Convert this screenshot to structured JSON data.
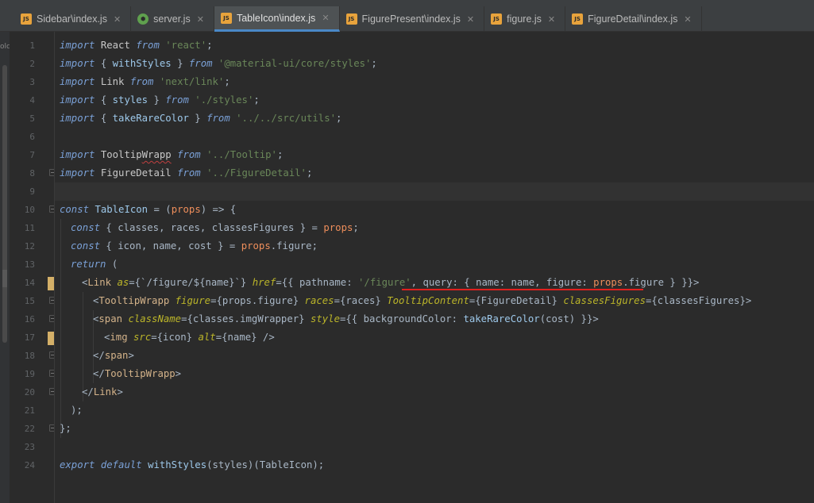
{
  "tabs": [
    {
      "label": "Sidebar\\index.js",
      "icon": "js-file-icon",
      "type": "js",
      "active": false
    },
    {
      "label": "server.js",
      "icon": "nodejs-file-icon",
      "type": "node",
      "active": false
    },
    {
      "label": "TableIcon\\index.js",
      "icon": "js-file-icon",
      "type": "js",
      "active": true
    },
    {
      "label": "FigurePresent\\index.js",
      "icon": "js-file-icon",
      "type": "js",
      "active": false
    },
    {
      "label": "figure.js",
      "icon": "js-file-icon",
      "type": "js",
      "active": false
    },
    {
      "label": "FigureDetail\\index.js",
      "icon": "js-file-icon",
      "type": "js",
      "active": false
    }
  ],
  "left_strip_label": "olc",
  "line_numbers": [
    "1",
    "2",
    "3",
    "4",
    "5",
    "6",
    "7",
    "8",
    "9",
    "10",
    "11",
    "12",
    "13",
    "14",
    "15",
    "16",
    "17",
    "18",
    "19",
    "20",
    "21",
    "22",
    "23",
    "24"
  ],
  "current_line": "9",
  "code": {
    "l1": [
      "import",
      " React ",
      "from",
      " 'react'",
      ";"
    ],
    "l2": [
      "import",
      " { ",
      "withStyles",
      " } ",
      "from",
      " '@material-ui/core/styles'",
      ";"
    ],
    "l3": [
      "import",
      " Link ",
      "from",
      " 'next/link'",
      ";"
    ],
    "l4": [
      "import",
      " { ",
      "styles",
      " } ",
      "from",
      " './styles'",
      ";"
    ],
    "l5": [
      "import",
      " { ",
      "takeRareColor",
      " } ",
      "from",
      " '../../src/utils'",
      ";"
    ],
    "l7": [
      "import",
      " Tooltip",
      "Wrapp",
      " ",
      "from",
      " '../Tooltip'",
      ";"
    ],
    "l8": [
      "import",
      " FigureDetail ",
      "from",
      " '../FigureDetail'",
      ";"
    ],
    "l10": [
      "const",
      " ",
      "TableIcon",
      " = (",
      "props",
      ") => {"
    ],
    "l11": [
      "const",
      " { classes, races, classesFigures } = ",
      "props",
      ";"
    ],
    "l12": [
      "const",
      " { icon, name, cost } = ",
      "props",
      ".figure;"
    ],
    "l13": [
      "return",
      " ("
    ],
    "l14": [
      "<",
      "Link",
      " ",
      "as",
      "={`/figure/${name}`} ",
      "href",
      "={{ pathname: ",
      "'/figure'",
      ", query: { name: name, figure: ",
      "props",
      ".figure } }}>"
    ],
    "l15": [
      "<",
      "TooltipWrapp",
      " ",
      "figure",
      "={props.figure} ",
      "races",
      "={races} ",
      "TooltipContent",
      "={FigureDetail} ",
      "classesFigures",
      "={classesFigures}>"
    ],
    "l16": [
      "<",
      "span",
      " ",
      "className",
      "={classes.imgWrapper} ",
      "style",
      "={{ backgroundColor: ",
      "takeRareColor",
      "(cost) }}>"
    ],
    "l17": [
      "<",
      "img",
      " ",
      "src",
      "={icon} ",
      "alt",
      "={name} />"
    ],
    "l18": [
      "</",
      "span",
      ">"
    ],
    "l19": [
      "</",
      "TooltipWrapp",
      ">"
    ],
    "l20": [
      "</",
      "Link",
      ">"
    ],
    "l21": [
      ");"
    ],
    "l22": [
      "};"
    ],
    "l24": [
      "export",
      " ",
      "default",
      " ",
      "withStyles",
      "(styles)(TableIcon);"
    ]
  }
}
